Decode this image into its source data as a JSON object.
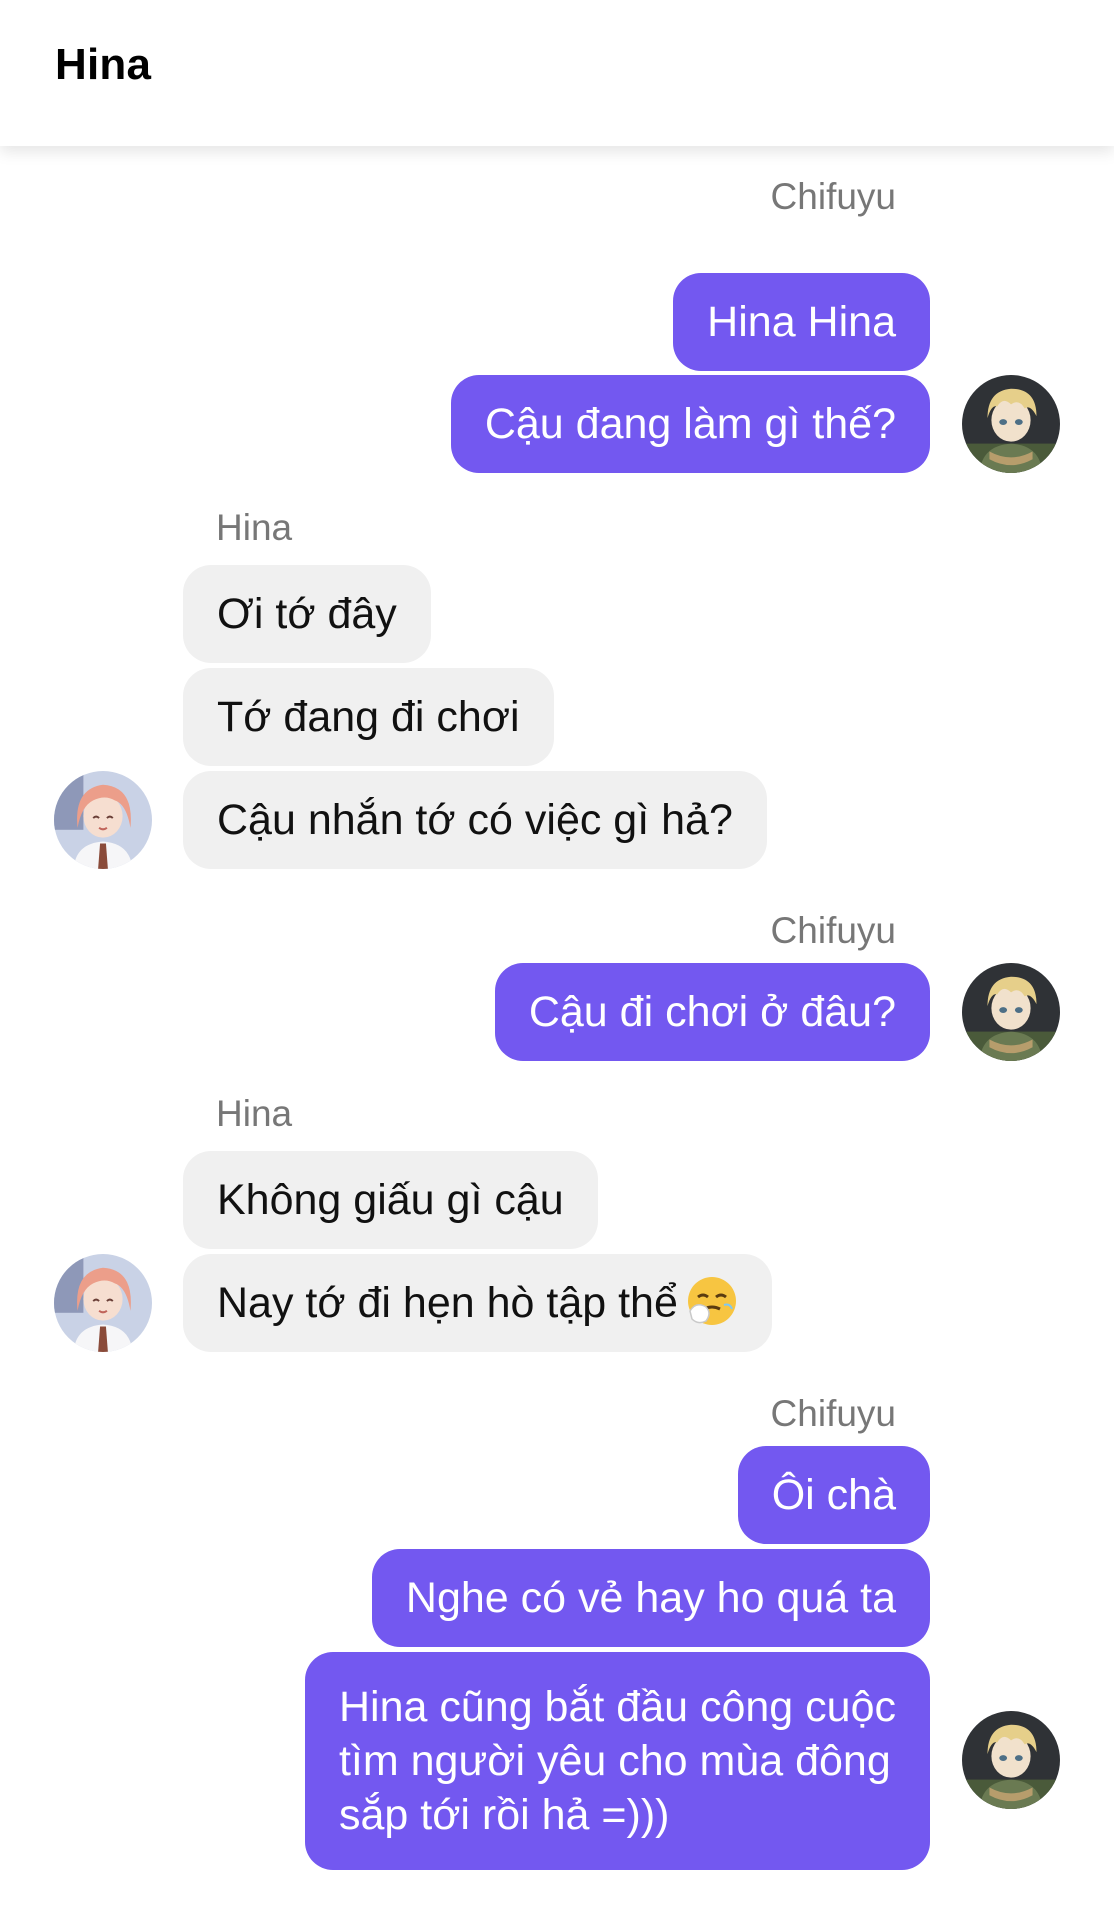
{
  "header": {
    "title": "Hina"
  },
  "groups": [
    {
      "direction": "out",
      "sender": "Chifuyu",
      "messages": [
        "Hina Hina",
        "Cậu đang làm gì thế?"
      ],
      "avatar": "chifuyu-avatar"
    },
    {
      "direction": "in",
      "sender": "Hina",
      "messages": [
        "Ơi tớ đây",
        "Tớ đang đi chơi",
        "Cậu nhắn tớ có việc gì hả?"
      ],
      "avatar": "hina-avatar"
    },
    {
      "direction": "out",
      "sender": "Chifuyu",
      "messages": [
        "Cậu đi chơi ở đâu?"
      ],
      "avatar": "chifuyu-avatar"
    },
    {
      "direction": "in",
      "sender": "Hina",
      "messages": [
        "Không giấu gì cậu",
        "Nay tớ đi hẹn hò tập thể"
      ],
      "emoji": "sneezing-face-emoji",
      "avatar": "hina-avatar"
    },
    {
      "direction": "out",
      "sender": "Chifuyu",
      "messages": [
        "Ôi chà",
        "Nghe có vẻ hay ho quá ta",
        [
          "Hina cũng bắt đầu công cuộc",
          "tìm người yêu cho mùa đông",
          "sắp tới rồi hả =)))"
        ]
      ],
      "avatar": "chifuyu-avatar"
    }
  ],
  "colors": {
    "outgoing_bubble": "#7358f0",
    "incoming_bubble": "#f0f0f0",
    "sender_label": "#777777"
  }
}
